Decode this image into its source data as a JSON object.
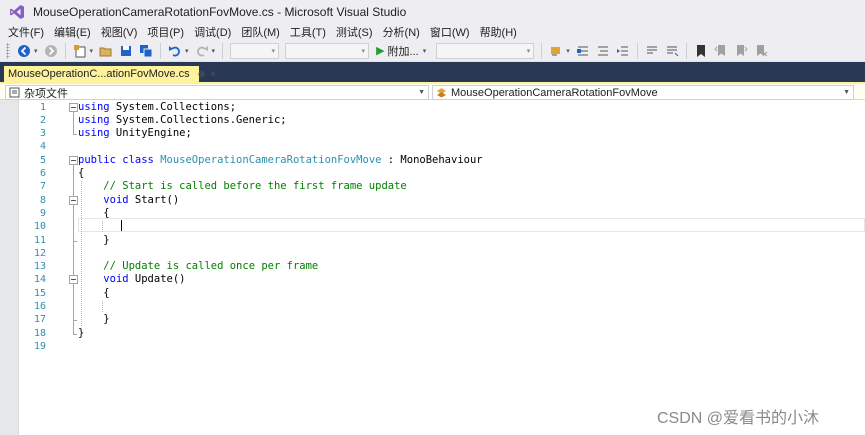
{
  "window": {
    "title": "MouseOperationCameraRotationFovMove.cs - Microsoft Visual Studio"
  },
  "menu": [
    "文件(F)",
    "编辑(E)",
    "视图(V)",
    "项目(P)",
    "调试(D)",
    "团队(M)",
    "工具(T)",
    "测试(S)",
    "分析(N)",
    "窗口(W)",
    "帮助(H)"
  ],
  "toolbar": {
    "attach_label": "附加...",
    "icons": [
      "back-icon",
      "forward-icon",
      "new-project-icon",
      "open-file-icon",
      "save-icon",
      "save-all-icon",
      "undo-icon",
      "redo-icon",
      "start-icon",
      "find-icon",
      "bookmark-icon"
    ]
  },
  "tab": {
    "label": "MouseOperationC...ationFovMove.cs",
    "pin": "⊕",
    "close": "×"
  },
  "navbar": {
    "scope": "杂项文件",
    "member": "MouseOperationCameraRotationFovMove"
  },
  "editor": {
    "lines": [
      {
        "n": "1",
        "tokens": [
          [
            "kw",
            "using"
          ],
          [
            "tx",
            " System.Collections;"
          ]
        ]
      },
      {
        "n": "2",
        "tokens": [
          [
            "kw",
            "using"
          ],
          [
            "tx",
            " System.Collections.Generic;"
          ]
        ]
      },
      {
        "n": "3",
        "tokens": [
          [
            "kw",
            "using"
          ],
          [
            "tx",
            " UnityEngine;"
          ]
        ]
      },
      {
        "n": "4",
        "tokens": []
      },
      {
        "n": "5",
        "tokens": [
          [
            "kw",
            "public"
          ],
          [
            "tx",
            " "
          ],
          [
            "kw",
            "class"
          ],
          [
            "tx",
            " "
          ],
          [
            "ty",
            "MouseOperationCameraRotationFovMove"
          ],
          [
            "tx",
            " : MonoBehaviour"
          ]
        ]
      },
      {
        "n": "6",
        "tokens": [
          [
            "tx",
            "{"
          ]
        ]
      },
      {
        "n": "7",
        "tokens": [
          [
            "tx",
            "    "
          ],
          [
            "cm",
            "// Start is called before the first frame update"
          ]
        ]
      },
      {
        "n": "8",
        "tokens": [
          [
            "tx",
            "    "
          ],
          [
            "kw",
            "void"
          ],
          [
            "tx",
            " Start()"
          ]
        ]
      },
      {
        "n": "9",
        "tokens": [
          [
            "tx",
            "    {"
          ]
        ]
      },
      {
        "n": "10",
        "tokens": []
      },
      {
        "n": "11",
        "tokens": [
          [
            "tx",
            "    }"
          ]
        ]
      },
      {
        "n": "12",
        "tokens": []
      },
      {
        "n": "13",
        "tokens": [
          [
            "tx",
            "    "
          ],
          [
            "cm",
            "// Update is called once per frame"
          ]
        ]
      },
      {
        "n": "14",
        "tokens": [
          [
            "tx",
            "    "
          ],
          [
            "kw",
            "void"
          ],
          [
            "tx",
            " Update()"
          ]
        ]
      },
      {
        "n": "15",
        "tokens": [
          [
            "tx",
            "    {"
          ]
        ]
      },
      {
        "n": "16",
        "tokens": []
      },
      {
        "n": "17",
        "tokens": [
          [
            "tx",
            "    }"
          ]
        ]
      },
      {
        "n": "18",
        "tokens": [
          [
            "tx",
            "}"
          ]
        ]
      },
      {
        "n": "19",
        "tokens": []
      }
    ],
    "current_line": 10
  },
  "watermark": "CSDN @爱看书的小沐",
  "colors": {
    "keyword": "#0000ff",
    "type": "#2b91af",
    "comment": "#008000",
    "tab_active": "#fff29d",
    "doc_band": "#293955",
    "chrome": "#eeeef2"
  }
}
